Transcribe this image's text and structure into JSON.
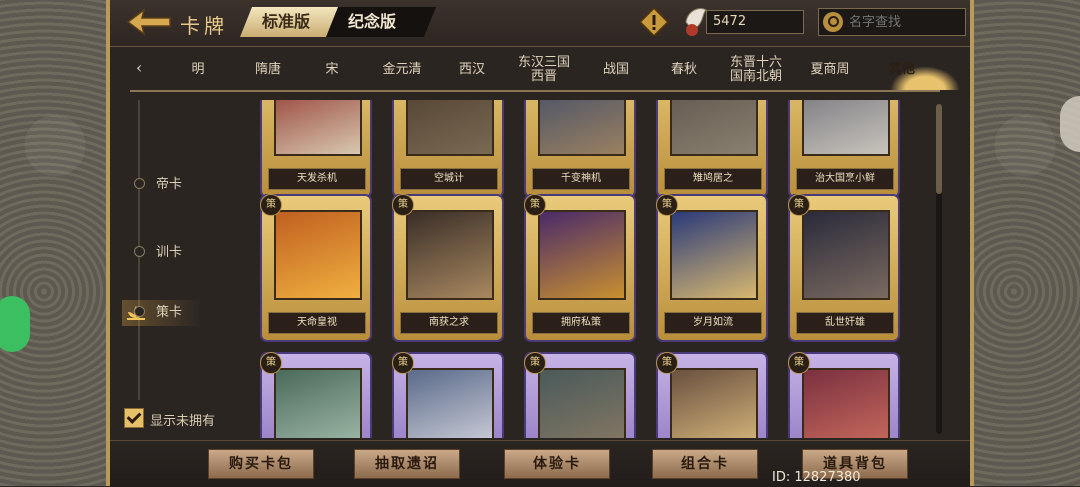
{
  "header": {
    "title": "卡牌",
    "segments": [
      "标准版",
      "纪念版"
    ],
    "coin_value": "5472",
    "search_placeholder": "名字查找"
  },
  "tabs": [
    {
      "label": "明"
    },
    {
      "label": "隋唐"
    },
    {
      "label": "宋"
    },
    {
      "label": "金元清"
    },
    {
      "label": "西汉"
    },
    {
      "label": "东汉三国\n西晋"
    },
    {
      "label": "战国"
    },
    {
      "label": "春秋"
    },
    {
      "label": "东晋十六\n国南北朝"
    },
    {
      "label": "夏商周"
    },
    {
      "label": "其他"
    }
  ],
  "side_nav": [
    {
      "label": "帝卡"
    },
    {
      "label": "训卡"
    },
    {
      "label": "策卡"
    }
  ],
  "show_unowned_label": "显示未拥有",
  "cards": [
    {
      "name": "天发杀机",
      "badge": ""
    },
    {
      "name": "空城计",
      "badge": ""
    },
    {
      "name": "千变神机",
      "badge": ""
    },
    {
      "name": "雉鸠居之",
      "badge": ""
    },
    {
      "name": "治大国烹小鲜",
      "badge": ""
    },
    {
      "name": "天命皇视",
      "badge": "策"
    },
    {
      "name": "南获之求",
      "badge": "策"
    },
    {
      "name": "拥府私策",
      "badge": "策"
    },
    {
      "name": "岁月如流",
      "badge": "策"
    },
    {
      "name": "乱世奸雄",
      "badge": "策"
    },
    {
      "name": "",
      "badge": "策"
    },
    {
      "name": "",
      "badge": "策"
    },
    {
      "name": "",
      "badge": "策"
    },
    {
      "name": "",
      "badge": "策"
    },
    {
      "name": "",
      "badge": "策"
    }
  ],
  "bottom_buttons": [
    "购买卡包",
    "抽取遗诏",
    "体验卡",
    "组合卡",
    "道具背包"
  ],
  "player_id": "ID: 12827380"
}
